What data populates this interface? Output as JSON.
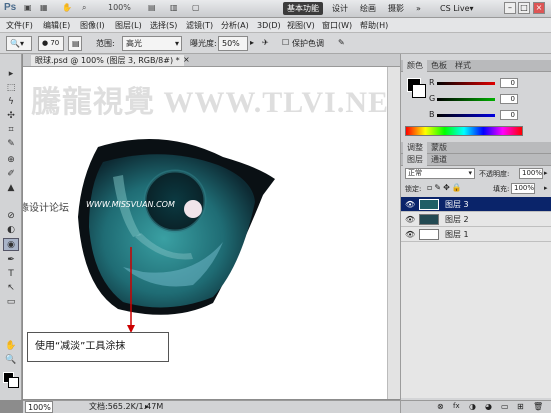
{
  "titlebar": {
    "logo": "Ps",
    "zoom": "100%",
    "workspaces": [
      "基本功能",
      "设计",
      "绘画",
      "摄影"
    ],
    "more": "»",
    "cslive": "CS Live▾",
    "minimize": "–",
    "maximize": "□",
    "close": "×"
  },
  "menu": [
    "文件(F)",
    "编辑(E)",
    "图像(I)",
    "图层(L)",
    "选择(S)",
    "滤镜(T)",
    "分析(A)",
    "3D(D)",
    "视图(V)",
    "窗口(W)",
    "帮助(H)"
  ],
  "options": {
    "brush_size": "70",
    "range_label": "范围:",
    "range_value": "高光",
    "exposure_label": "曝光度:",
    "exposure_value": "50%",
    "protect_label": "保护色调"
  },
  "tools": [
    "▸",
    "⬚",
    "ϟ",
    "✣",
    "⌗",
    "✎",
    "⊕",
    "✐",
    "▲",
    "⊘",
    "◐",
    "◉",
    "✒",
    "T",
    "↖",
    "▭",
    "✋",
    "🔍"
  ],
  "document": {
    "tab_label": "眼球.psd @ 100% (图层 3, RGB/8#) *",
    "tab_close": "×",
    "watermark": "騰龍視覺 WWW.TLVI.NET",
    "forum_mark": "思缘设计论坛",
    "forum_url": "WWW.MISSVUAN.COM",
    "callout": "使用“减淡”工具涂抹"
  },
  "status": {
    "zoom": "100%",
    "doc_info": "文档:565.2K/1.47M"
  },
  "color_panel": {
    "tabs": [
      "颜色",
      "色板",
      "样式"
    ],
    "channels": [
      {
        "label": "R",
        "value": "0",
        "color": "#e00000"
      },
      {
        "label": "G",
        "value": "0",
        "color": "#00b000"
      },
      {
        "label": "B",
        "value": "0",
        "color": "#0000e0"
      }
    ]
  },
  "adjust_tabs": [
    "调整",
    "蒙版"
  ],
  "layers_panel": {
    "tabs": [
      "图层",
      "通道"
    ],
    "blend_mode": "正常",
    "opacity_label": "不透明度:",
    "opacity_value": "100%",
    "lock_label": "锁定:",
    "fill_label": "填充:",
    "fill_value": "100%",
    "layers": [
      {
        "name": "图层 3",
        "selected": true
      },
      {
        "name": "图层 2",
        "selected": false
      },
      {
        "name": "图层 1",
        "selected": false
      }
    ],
    "footer_icons": [
      "⊗",
      "fx",
      "◑",
      "◕",
      "▭",
      "⊞",
      "🗑"
    ]
  },
  "colors": {
    "accent": "#0a246a",
    "iris_dark": "#0d2a33",
    "iris_light": "#2a8a8f",
    "arrow": "#cc0000"
  }
}
